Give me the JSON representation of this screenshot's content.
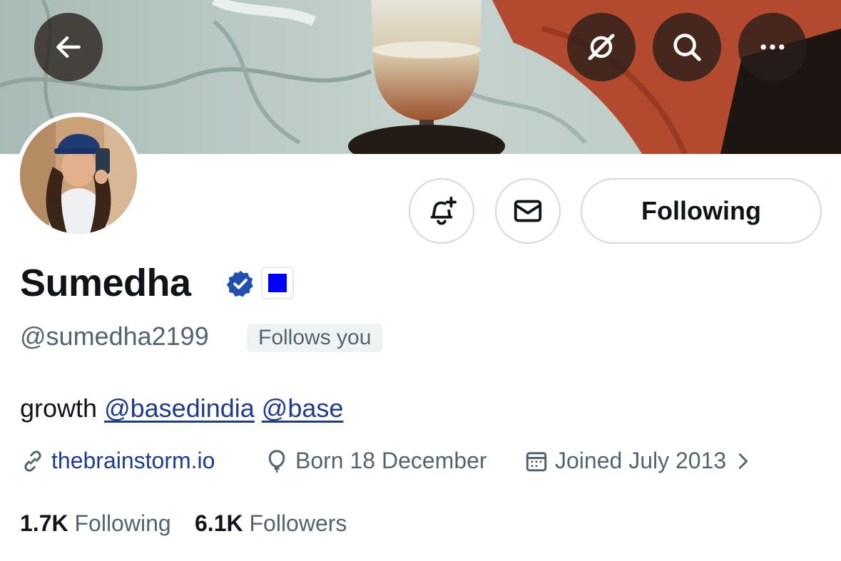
{
  "profile": {
    "name": "Sumedha",
    "handle": "@sumedha2199",
    "follows_you": "Follows you",
    "bio": {
      "text": "growth",
      "mentions": [
        "@basedindia",
        "@base"
      ]
    },
    "website": "thebrainstorm.io",
    "birthday": "Born 18 December",
    "joined": "Joined July 2013",
    "following_count": "1.7K",
    "following_label": "Following",
    "followers_count": "6.1K",
    "followers_label": "Followers"
  },
  "actions": {
    "follow_state_label": "Following"
  },
  "icons": {
    "back": "arrow-left-icon",
    "grok": "grok-icon",
    "search": "search-icon",
    "more": "more-icon",
    "notify": "bell-plus-icon",
    "message": "envelope-icon",
    "verified": "verified-badge-icon",
    "affiliation": "affiliation-badge-icon",
    "link": "link-icon",
    "birthday": "balloon-icon",
    "calendar": "calendar-icon",
    "chevron": "chevron-right-icon"
  },
  "colors": {
    "accent_link": "#1d3b8f",
    "verified": "#1f4fb0",
    "affiliation_square": "#0000ff",
    "muted_text": "#536471"
  }
}
